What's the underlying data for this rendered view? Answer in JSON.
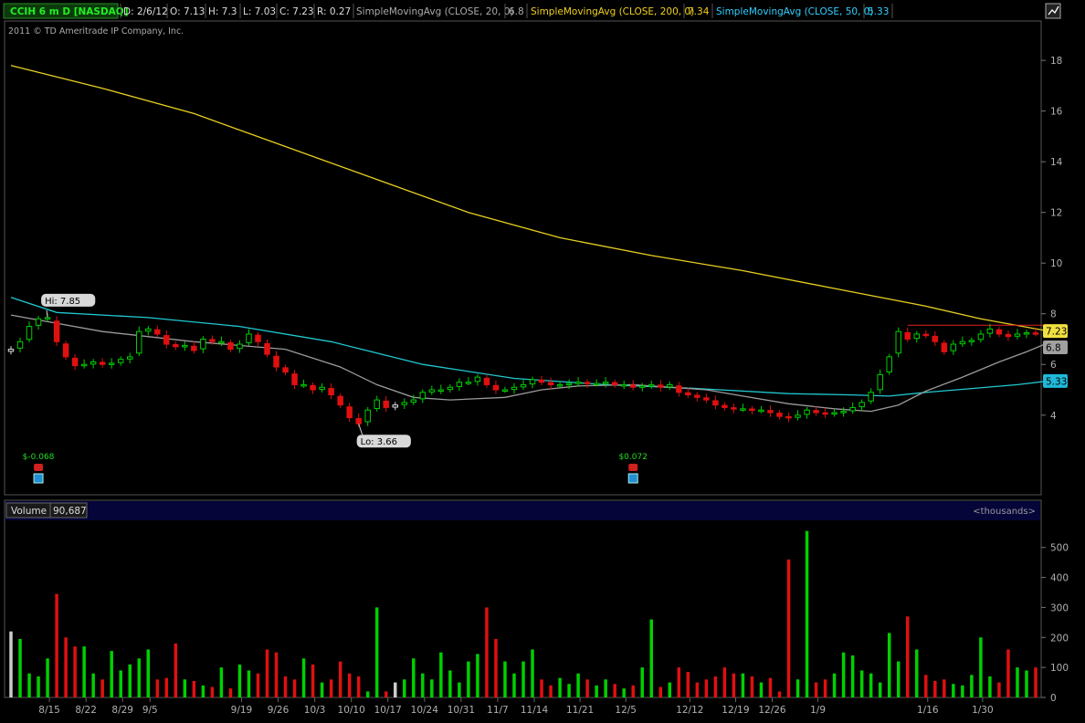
{
  "header": {
    "symbol_badge": "CCIH 6 m D [NASDAQ]",
    "date": "D: 2/6/12",
    "open": "O: 7.13",
    "high": "H: 7.3",
    "low": "L: 7.03",
    "close": "C: 7.23",
    "range": "R: 0.27",
    "sma20_label": "SimpleMovingAvg (CLOSE, 20, 0)",
    "sma20_value": "6.8",
    "sma200_label": "SimpleMovingAvg (CLOSE, 200, 0)",
    "sma200_value": "7.34",
    "sma50_label": "SimpleMovingAvg (CLOSE, 50, 0)",
    "sma50_value": "5.33",
    "copyright": "2011 © TD Ameritrade IP Company, Inc."
  },
  "volume_header": {
    "label": "Volume",
    "value": "90,687",
    "units": "<thousands>"
  },
  "colors": {
    "up": "#00d000",
    "down": "#e01010",
    "sma20": "#9a9a9a",
    "sma50": "#20c8d0",
    "sma200": "#e8d020",
    "grid_frame": "#555555",
    "background": "#000000"
  },
  "chart_data": [
    {
      "type": "candlestick",
      "title": "CCIH 6 m D [NASDAQ]",
      "y_ticks": [
        4,
        6,
        8,
        10,
        12,
        14,
        16,
        18
      ],
      "ylim": [
        2.6,
        19.4
      ],
      "x_ticks": [
        "8/15",
        "8/22",
        "8/29",
        "9/5",
        "9/19",
        "9/26",
        "10/3",
        "10/10",
        "10/17",
        "10/24",
        "10/31",
        "11/7",
        "11/14",
        "11/21",
        "12/5",
        "12/12",
        "12/19",
        "12/26",
        "1/9",
        "1/16",
        "1/30"
      ],
      "closes": [
        6.6,
        6.9,
        7.5,
        7.8,
        7.85,
        6.9,
        6.3,
        5.95,
        6.0,
        6.1,
        6.0,
        6.05,
        6.2,
        6.3,
        7.3,
        7.4,
        7.2,
        6.8,
        6.7,
        6.75,
        6.55,
        7.0,
        6.9,
        6.9,
        6.6,
        6.8,
        7.2,
        6.9,
        6.4,
        5.9,
        5.7,
        5.2,
        5.2,
        5.0,
        5.1,
        4.8,
        4.4,
        3.9,
        3.66,
        4.2,
        4.6,
        4.3,
        4.4,
        4.5,
        4.6,
        4.9,
        5.0,
        5.0,
        5.1,
        5.3,
        5.3,
        5.5,
        5.2,
        5.0,
        5.0,
        5.1,
        5.2,
        5.4,
        5.3,
        5.2,
        5.2,
        5.25,
        5.3,
        5.25,
        5.25,
        5.3,
        5.2,
        5.2,
        5.1,
        5.15,
        5.2,
        5.1,
        5.2,
        4.9,
        4.8,
        4.7,
        4.6,
        4.4,
        4.3,
        4.25,
        4.25,
        4.2,
        4.2,
        4.1,
        3.95,
        3.9,
        4.0,
        4.2,
        4.1,
        4.05,
        4.1,
        4.15,
        4.3,
        4.5,
        4.9,
        5.6,
        6.3,
        7.3,
        7.0,
        7.2,
        7.15,
        6.9,
        6.5,
        6.8,
        6.9,
        6.95,
        7.2,
        7.4,
        7.2,
        7.1,
        7.2,
        7.25,
        7.23
      ],
      "series": [
        {
          "name": "SimpleMovingAvg (CLOSE, 20, 0)",
          "last": 6.8,
          "values": [
            [
              0,
              7.95
            ],
            [
              10,
              7.3
            ],
            [
              20,
              6.9
            ],
            [
              30,
              6.6
            ],
            [
              36,
              5.9
            ],
            [
              40,
              5.2
            ],
            [
              44,
              4.7
            ],
            [
              48,
              4.6
            ],
            [
              54,
              4.7
            ],
            [
              58,
              5.0
            ],
            [
              62,
              5.15
            ],
            [
              68,
              5.2
            ],
            [
              72,
              5.1
            ],
            [
              76,
              5.0
            ],
            [
              80,
              4.75
            ],
            [
              85,
              4.45
            ],
            [
              90,
              4.25
            ],
            [
              94,
              4.15
            ],
            [
              97,
              4.4
            ],
            [
              100,
              4.95
            ],
            [
              104,
              5.5
            ],
            [
              108,
              6.1
            ],
            [
              111,
              6.5
            ],
            [
              113,
              6.8
            ]
          ]
        },
        {
          "name": "SimpleMovingAvg (CLOSE, 50, 0)",
          "last": 5.33,
          "values": [
            [
              0,
              8.65
            ],
            [
              5,
              8.05
            ],
            [
              15,
              7.85
            ],
            [
              25,
              7.5
            ],
            [
              35,
              6.9
            ],
            [
              45,
              6.0
            ],
            [
              55,
              5.45
            ],
            [
              65,
              5.2
            ],
            [
              75,
              5.05
            ],
            [
              85,
              4.85
            ],
            [
              92,
              4.8
            ],
            [
              96,
              4.75
            ],
            [
              100,
              4.9
            ],
            [
              105,
              5.05
            ],
            [
              110,
              5.2
            ],
            [
              113,
              5.33
            ]
          ]
        },
        {
          "name": "SimpleMovingAvg (CLOSE, 200, 0)",
          "last": 7.34,
          "values": [
            [
              0,
              17.8
            ],
            [
              10,
              16.9
            ],
            [
              20,
              15.9
            ],
            [
              30,
              14.6
            ],
            [
              40,
              13.3
            ],
            [
              50,
              12.0
            ],
            [
              60,
              11.0
            ],
            [
              70,
              10.3
            ],
            [
              80,
              9.7
            ],
            [
              90,
              9.0
            ],
            [
              100,
              8.3
            ],
            [
              106,
              7.8
            ],
            [
              113,
              7.34
            ]
          ]
        }
      ],
      "annotations": [
        {
          "text": "Hi: 7.85",
          "bar": 4,
          "value": 7.85
        },
        {
          "text": "Lo: 3.66",
          "bar": 38,
          "value": 3.66
        },
        {
          "text": "$-0.068",
          "bar": 3,
          "kind": "earnings"
        },
        {
          "text": "$0.072",
          "bar": 68,
          "kind": "earnings"
        }
      ],
      "price_labels": [
        "7.23",
        "6.8",
        "5.33"
      ],
      "resistance_line": {
        "value": 7.55,
        "from_bar": 98,
        "to_bar": 113
      }
    },
    {
      "type": "bar",
      "title": "Volume",
      "units": "<thousands>",
      "y_ticks": [
        0,
        100,
        200,
        300,
        400,
        500
      ],
      "ylim": [
        0,
        560
      ],
      "values": [
        220,
        195,
        80,
        70,
        130,
        345,
        200,
        170,
        170,
        80,
        60,
        155,
        90,
        110,
        130,
        160,
        60,
        65,
        180,
        60,
        55,
        40,
        35,
        100,
        30,
        110,
        90,
        80,
        160,
        150,
        70,
        60,
        130,
        110,
        50,
        60,
        120,
        80,
        70,
        20,
        300,
        20,
        50,
        60,
        130,
        80,
        60,
        150,
        90,
        50,
        120,
        145,
        300,
        195,
        120,
        80,
        120,
        160,
        60,
        40,
        65,
        45,
        80,
        60,
        40,
        60,
        45,
        30,
        40,
        100,
        260,
        35,
        50,
        100,
        85,
        50,
        60,
        70,
        100,
        80,
        80,
        70,
        50,
        65,
        20,
        460,
        60,
        555,
        50,
        60,
        80,
        150,
        140,
        90,
        80,
        50,
        215,
        120,
        270,
        160,
        75,
        55,
        60,
        45,
        40,
        75,
        200,
        70,
        50,
        160,
        100,
        90,
        100
      ]
    }
  ]
}
